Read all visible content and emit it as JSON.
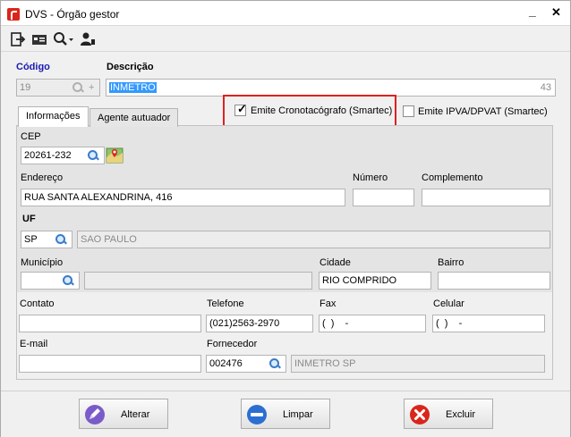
{
  "window": {
    "title": "DVS - Órgão gestor",
    "minimize_glyph": "_",
    "close_glyph": "✕"
  },
  "toolbar": {
    "icons": [
      "exit-icon",
      "card-icon",
      "search-dropdown-icon",
      "user-icon"
    ]
  },
  "header": {
    "codigo_label": "Código",
    "codigo_value": "19",
    "codigo_add_glyph": "+",
    "descricao_label": "Descrição",
    "descricao_value": "INMETRO",
    "descricao_counter": "43"
  },
  "tabs": [
    {
      "label": "Informações",
      "active": true
    },
    {
      "label": "Agente autuador",
      "active": false
    }
  ],
  "checkboxes": {
    "cronotacografo": {
      "label": "Emite Cronotacógrafo (Smartec)",
      "checked": true
    },
    "ipva": {
      "label": "Emite IPVA/DPVAT (Smartec)",
      "checked": false
    }
  },
  "form": {
    "cep_label": "CEP",
    "cep_value": "20261-232",
    "endereco_label": "Endereço",
    "endereco_value": "RUA SANTA ALEXANDRINA, 416",
    "numero_label": "Número",
    "numero_value": "",
    "complemento_label": "Complemento",
    "complemento_value": "",
    "uf_label": "UF",
    "uf_value": "SP",
    "uf_name": "SAO PAULO",
    "municipio_label": "Município",
    "municipio_value": "",
    "municipio_name": "",
    "cidade_label": "Cidade",
    "cidade_value": "RIO COMPRIDO",
    "bairro_label": "Bairro",
    "bairro_value": "",
    "contato_label": "Contato",
    "contato_value": "",
    "telefone_label": "Telefone",
    "telefone_value": "(021)2563-2970",
    "fax_label": "Fax",
    "fax_value": "(  )    -",
    "celular_label": "Celular",
    "celular_value": "(  )    -",
    "email_label": "E-mail",
    "email_value": "",
    "fornecedor_label": "Fornecedor",
    "fornecedor_value": "002476",
    "fornecedor_name": "INMETRO SP"
  },
  "buttons": {
    "alterar": "Alterar",
    "limpar": "Limpar",
    "excluir": "Excluir"
  },
  "colors": {
    "label_blue": "#1a1ab0",
    "highlight_red": "#e02020",
    "selection_blue": "#3399ff"
  }
}
